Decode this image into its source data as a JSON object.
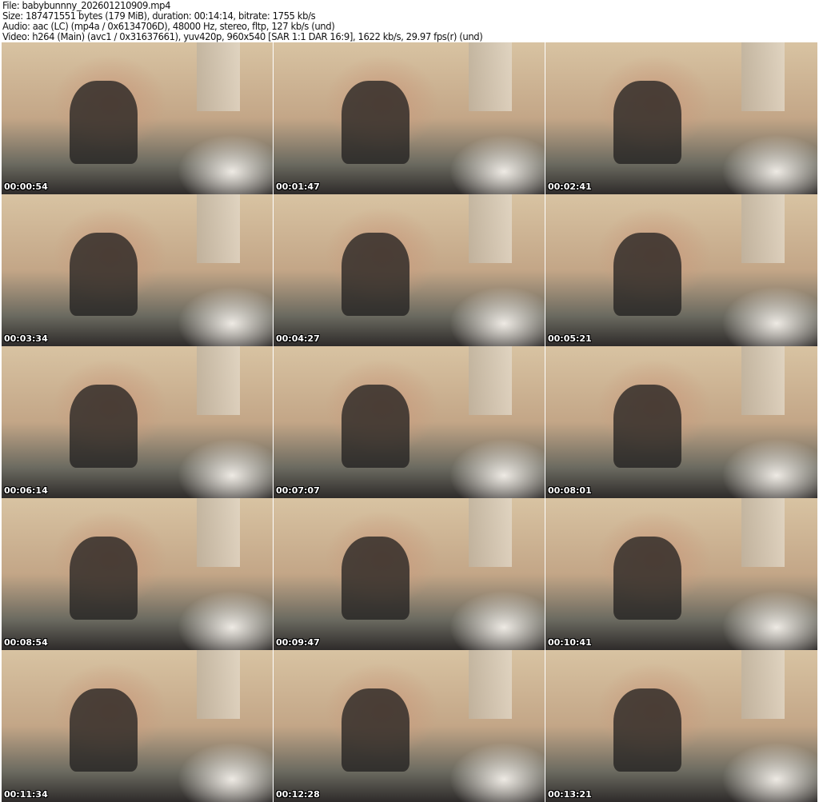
{
  "header": {
    "file": "File: babybunnny_202601210909.mp4",
    "size": "Size: 187471551 bytes (179 MiB), duration: 00:14:14, bitrate: 1755 kb/s",
    "audio": "Audio: aac (LC) (mp4a / 0x6134706D), 48000 Hz, stereo, fltp, 127 kb/s (und)",
    "video": "Video: h264 (Main) (avc1 / 0x31637661), yuv420p, 960x540 [SAR 1:1 DAR 16:9], 1622 kb/s, 29.97 fps(r) (und)"
  },
  "thumbnails": [
    {
      "time": "00:00:54"
    },
    {
      "time": "00:01:47"
    },
    {
      "time": "00:02:41"
    },
    {
      "time": "00:03:34"
    },
    {
      "time": "00:04:27"
    },
    {
      "time": "00:05:21"
    },
    {
      "time": "00:06:14"
    },
    {
      "time": "00:07:07"
    },
    {
      "time": "00:08:01"
    },
    {
      "time": "00:08:54"
    },
    {
      "time": "00:09:47"
    },
    {
      "time": "00:10:41"
    },
    {
      "time": "00:11:34"
    },
    {
      "time": "00:12:28"
    },
    {
      "time": "00:13:21"
    }
  ]
}
